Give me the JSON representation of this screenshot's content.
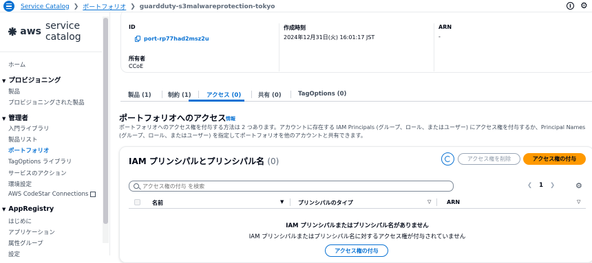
{
  "breadcrumb": {
    "items": [
      "Service Catalog",
      "ポートフォリオ"
    ],
    "current": "guardduty-s3malwareprotection-tokyo"
  },
  "logo": {
    "brand": "aws",
    "product": "service catalog"
  },
  "sidebar": {
    "home": "ホーム",
    "provisioning": {
      "heading": "プロビジョニング",
      "items": [
        "製品",
        "プロビジョニングされた製品"
      ]
    },
    "admin": {
      "heading": "管理者",
      "items": [
        "入門ライブラリ",
        "製品リスト",
        "ポートフォリオ",
        "TagOptions ライブラリ",
        "サービスのアクション",
        "環境設定",
        "AWS CodeStar Connections"
      ]
    },
    "appregistry": {
      "heading": "AppRegistry",
      "items": [
        "はじめに",
        "アプリケーション",
        "属性グループ",
        "設定"
      ]
    }
  },
  "summary": {
    "id_label": "ID",
    "id_value": "port-rp77had2msz2u",
    "created_label": "作成時刻",
    "created_value": "2024年12月31日(火) 16:01:17 JST",
    "arn_label": "ARN",
    "arn_value": "-",
    "owner_label": "所有者",
    "owner_value": "CCoE"
  },
  "tabs": [
    "製品 (1)",
    "制約 (1)",
    "アクセス (0)",
    "共有 (0)",
    "TagOptions (0)"
  ],
  "access": {
    "title": "ポートフォリオへのアクセス",
    "info": "情報",
    "description": "ポートフォリオへのアクセス権を付与する方法は 2 つあります。アカウントに存在する IAM Principals (グループ、ロール、またはユーザー) にアクセス権を付与するか、Principal Names (グループ、ロール、またはユーザー) を指定してポートフォリオを他のアカウントと共有できます。"
  },
  "panel": {
    "title": "IAM プリンシパルとプリンシパル名",
    "count": "(0)",
    "remove_button": "アクセス権を削除",
    "grant_button": "アクセス権の付与",
    "search_placeholder": "アクセス権の付与 を検索",
    "page": "1",
    "columns": [
      "名前",
      "プリンシパルのタイプ",
      "ARN"
    ],
    "empty_title": "IAM プリンシパルまたはプリンシパル名がありません",
    "empty_desc": "IAM プリンシパルまたはプリンシパル名に対するアクセス権が付与されていません",
    "empty_button": "アクセス権の付与"
  }
}
